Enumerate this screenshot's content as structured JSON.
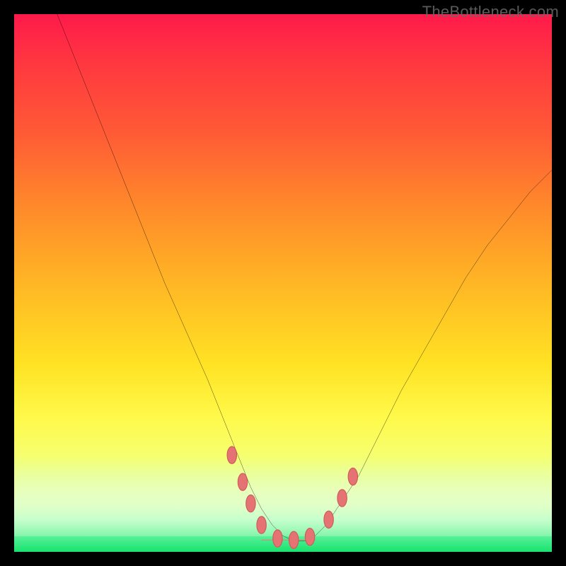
{
  "watermark": "TheBottleneck.com",
  "colors": {
    "frame": "#000000",
    "curve": "#000000",
    "marker_fill": "#e57373",
    "marker_stroke": "#cf5a5a"
  },
  "chart_data": {
    "type": "line",
    "title": "",
    "xlabel": "",
    "ylabel": "",
    "xlim": [
      0,
      100
    ],
    "ylim": [
      0,
      100
    ],
    "grid": false,
    "legend": false,
    "series": [
      {
        "name": "bottleneck-curve",
        "x": [
          8,
          12,
          16,
          20,
          24,
          28,
          32,
          36,
          40,
          42,
          44,
          46,
          48,
          50,
          52,
          54,
          56,
          58,
          60,
          64,
          68,
          72,
          76,
          80,
          84,
          88,
          92,
          96,
          100
        ],
        "values": [
          100,
          90,
          80,
          70,
          60,
          50,
          41,
          32,
          22,
          17,
          12,
          8,
          5,
          3,
          2,
          2,
          3,
          5,
          8,
          14,
          22,
          30,
          37,
          44,
          51,
          57,
          62,
          67,
          71
        ]
      }
    ],
    "markers": [
      {
        "x": 40.5,
        "y": 18,
        "r": 1.6
      },
      {
        "x": 42.5,
        "y": 13,
        "r": 1.6
      },
      {
        "x": 44.0,
        "y": 9,
        "r": 1.6
      },
      {
        "x": 46.0,
        "y": 5,
        "r": 1.6
      },
      {
        "x": 49.0,
        "y": 2.5,
        "r": 1.6
      },
      {
        "x": 52.0,
        "y": 2.2,
        "r": 1.6
      },
      {
        "x": 55.0,
        "y": 2.8,
        "r": 1.6
      },
      {
        "x": 58.5,
        "y": 6,
        "r": 1.6
      },
      {
        "x": 61.0,
        "y": 10,
        "r": 1.6
      },
      {
        "x": 63.0,
        "y": 14,
        "r": 1.6
      }
    ],
    "flat_segment": {
      "x0": 46,
      "x1": 56,
      "y": 2.2
    }
  }
}
